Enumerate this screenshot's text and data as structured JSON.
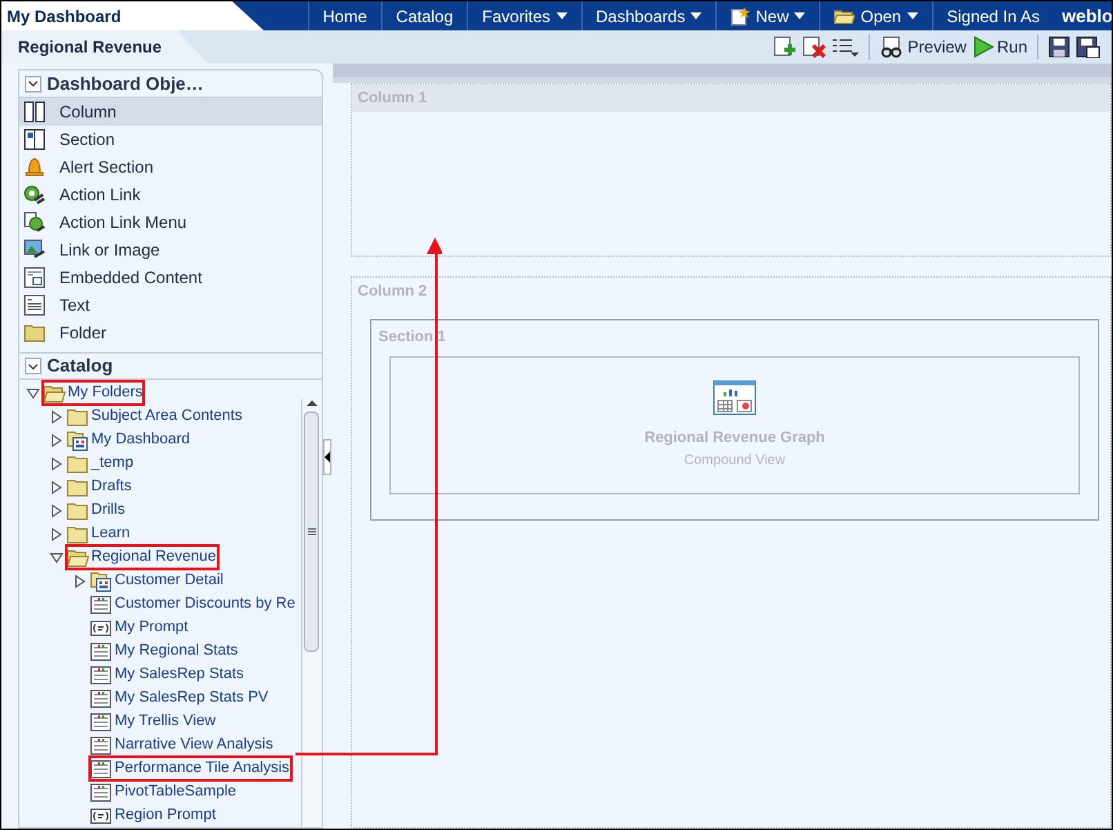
{
  "app_tab": {
    "title": "My Dashboard"
  },
  "nav": [
    {
      "label": "Home",
      "dropdown": false,
      "kind": "plain"
    },
    {
      "label": "Catalog",
      "dropdown": false,
      "kind": "plain"
    },
    {
      "label": "Favorites",
      "dropdown": true,
      "kind": "plain"
    },
    {
      "label": "Dashboards",
      "dropdown": true,
      "kind": "plain"
    },
    {
      "label": "New",
      "dropdown": true,
      "kind": "new"
    },
    {
      "label": "Open",
      "dropdown": true,
      "kind": "open"
    },
    {
      "label": "Signed In As",
      "dropdown": false,
      "kind": "plain"
    }
  ],
  "user": "weblo",
  "page_tab": {
    "title": "Regional Revenue"
  },
  "toolbar": [
    {
      "kind": "add"
    },
    {
      "kind": "delete"
    },
    {
      "kind": "list"
    },
    {
      "kind": "sep"
    },
    {
      "kind": "preview",
      "label": "Preview"
    },
    {
      "kind": "run",
      "label": "Run"
    },
    {
      "kind": "sep"
    },
    {
      "kind": "save"
    },
    {
      "kind": "saveas"
    }
  ],
  "objects": {
    "title": "Dashboard Obje…",
    "items": [
      {
        "label": "Column",
        "kind": "column",
        "selected": true
      },
      {
        "label": "Section",
        "kind": "section",
        "selected": false
      },
      {
        "label": "Alert Section",
        "kind": "alert",
        "selected": false
      },
      {
        "label": "Action Link",
        "kind": "action",
        "selected": false
      },
      {
        "label": "Action Link Menu",
        "kind": "actionmenu",
        "selected": false
      },
      {
        "label": "Link or Image",
        "kind": "image",
        "selected": false
      },
      {
        "label": "Embedded Content",
        "kind": "embedded",
        "selected": false
      },
      {
        "label": "Text",
        "kind": "text",
        "selected": false
      },
      {
        "label": "Folder",
        "kind": "folder",
        "selected": false
      }
    ]
  },
  "catalog": {
    "title": "Catalog",
    "tree": [
      {
        "label": "My Folders",
        "kind": "folder",
        "expanded": true,
        "highlighted": true,
        "children": [
          {
            "label": "Subject Area Contents",
            "kind": "folder",
            "expanded": false,
            "highlighted": false
          },
          {
            "label": "My Dashboard",
            "kind": "dashboard",
            "expanded": false,
            "highlighted": false
          },
          {
            "label": "_temp",
            "kind": "folder",
            "expanded": false,
            "highlighted": false
          },
          {
            "label": "Drafts",
            "kind": "folder",
            "expanded": false,
            "highlighted": false
          },
          {
            "label": "Drills",
            "kind": "folder",
            "expanded": false,
            "highlighted": false
          },
          {
            "label": "Learn",
            "kind": "folder",
            "expanded": false,
            "highlighted": false
          },
          {
            "label": "Regional Revenue",
            "kind": "folder",
            "expanded": true,
            "highlighted": true,
            "children": [
              {
                "label": "Customer Detail",
                "kind": "dashboard",
                "expanded": false,
                "highlighted": false
              },
              {
                "label": "Customer Discounts by Re",
                "kind": "analysis",
                "highlighted": false
              },
              {
                "label": "My Prompt",
                "kind": "prompt",
                "highlighted": false
              },
              {
                "label": "My Regional Stats",
                "kind": "analysis",
                "highlighted": false
              },
              {
                "label": "My SalesRep Stats",
                "kind": "analysis",
                "highlighted": false
              },
              {
                "label": "My SalesRep Stats PV",
                "kind": "analysis",
                "highlighted": false
              },
              {
                "label": "My Trellis View",
                "kind": "analysis",
                "highlighted": false
              },
              {
                "label": "Narrative View Analysis",
                "kind": "analysis",
                "highlighted": false
              },
              {
                "label": "Performance Tile Analysis",
                "kind": "analysis",
                "highlighted": true
              },
              {
                "label": "PivotTableSample",
                "kind": "analysis",
                "highlighted": false
              },
              {
                "label": "Region Prompt",
                "kind": "prompt",
                "highlighted": false
              }
            ]
          }
        ]
      }
    ]
  },
  "canvas": {
    "columns": [
      {
        "title": "Column 1"
      },
      {
        "title": "Column 2",
        "sections": [
          {
            "title": "Section 1",
            "items": [
              {
                "title": "Regional Revenue Graph",
                "subtitle": "Compound View"
              }
            ]
          }
        ]
      }
    ]
  }
}
